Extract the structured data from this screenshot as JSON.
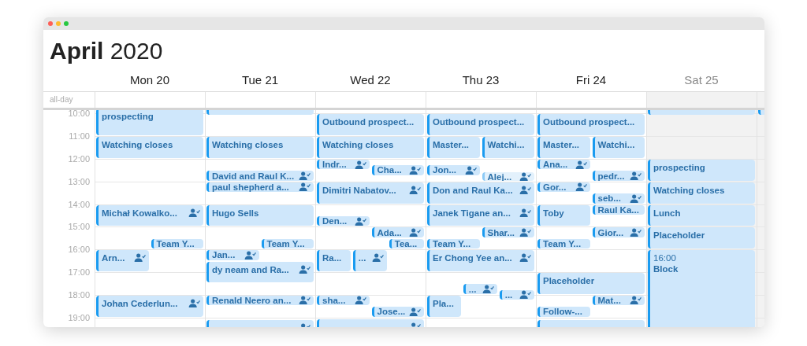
{
  "window": {
    "title": "**April** 2020"
  },
  "all_day_label": "all-day",
  "hours": [
    "10:00",
    "11:00",
    "12:00",
    "13:00",
    "14:00",
    "15:00",
    "16:00",
    "17:00",
    "18:00",
    "19:00"
  ],
  "days": [
    {
      "label": "Mon 20",
      "weekend": false,
      "events": [
        {
          "title": "prospecting",
          "guests": false
        },
        {
          "title": "Watching closes",
          "guests": false
        },
        {
          "title": "Michał Kowalko...",
          "guests": true
        },
        {
          "title": "Team Y...",
          "guests": false
        },
        {
          "title": "Arn...",
          "guests": true
        },
        {
          "title": "Johan Cederlun...",
          "guests": true
        }
      ]
    },
    {
      "label": "Tue 21",
      "weekend": false,
      "events": [
        {
          "guests": false
        },
        {
          "title": "Watching closes",
          "guests": false
        },
        {
          "title": "David and Raul K...",
          "guests": true
        },
        {
          "title": "paul shepherd a...",
          "guests": true
        },
        {
          "title": "Hugo Sells",
          "guests": false
        },
        {
          "title": "Team Y...",
          "guests": false
        },
        {
          "title": "Jan...",
          "guests": true
        },
        {
          "title": "dy neam and Ra...",
          "guests": true
        },
        {
          "title": "Renald Neero an...",
          "guests": true
        },
        {
          "guests": true
        }
      ]
    },
    {
      "label": "Wed 22",
      "weekend": false,
      "events": [
        {
          "title": "Outbound prospect...",
          "guests": false
        },
        {
          "title": "Watching closes",
          "guests": false
        },
        {
          "title": "Indr...",
          "guests": true
        },
        {
          "title": "Cha...",
          "guests": true
        },
        {
          "title": "Dimitri Nabatov...",
          "guests": true
        },
        {
          "title": "Den...",
          "guests": true
        },
        {
          "title": "Ada...",
          "guests": true
        },
        {
          "title": "Tea...",
          "guests": false
        },
        {
          "title": "Ra...",
          "guests": false
        },
        {
          "title": "...",
          "guests": true
        },
        {
          "title": "sha...",
          "guests": true
        },
        {
          "title": "Jose...",
          "guests": true
        },
        {
          "guests": true
        }
      ]
    },
    {
      "label": "Thu 23",
      "weekend": false,
      "events": [
        {
          "title": "Outbound prospect...",
          "guests": false
        },
        {
          "title": "Master...",
          "guests": false
        },
        {
          "title": "Watchi...",
          "guests": false
        },
        {
          "title": "Jon...",
          "guests": true
        },
        {
          "title": "Alej...",
          "guests": true,
          "ghost": true
        },
        {
          "title": "Don  and Raul Ka...",
          "guests": true
        },
        {
          "title": "Janek Tigane an...",
          "guests": true
        },
        {
          "title": "Shar...",
          "guests": true
        },
        {
          "title": "Team Y...",
          "guests": false
        },
        {
          "title": "Er Chong Yee an...",
          "guests": true
        },
        {
          "title": "...",
          "guests": true
        },
        {
          "title": "...",
          "guests": true
        },
        {
          "title": "Pla...",
          "guests": false
        }
      ]
    },
    {
      "label": "Fri 24",
      "weekend": false,
      "events": [
        {
          "title": "Outbound prospect...",
          "guests": false
        },
        {
          "title": "Master...",
          "guests": false
        },
        {
          "title": "Watchi...",
          "guests": false
        },
        {
          "title": "Ana...",
          "guests": true
        },
        {
          "title": "pedr...",
          "guests": true
        },
        {
          "title": "Gor...",
          "guests": true
        },
        {
          "title": "seb...",
          "guests": true
        },
        {
          "title": "Toby",
          "guests": false
        },
        {
          "title": "Raul Ka...",
          "guests": false
        },
        {
          "title": "Gior...",
          "guests": true
        },
        {
          "title": "Team Y...",
          "guests": false
        },
        {
          "title": "Placeholder",
          "guests": false
        },
        {
          "title": "Mat...",
          "guests": true
        },
        {
          "title": "Follow-...",
          "guests": false
        },
        {
          "guests": false
        }
      ]
    },
    {
      "label": "Sat 25",
      "weekend": true,
      "events": [
        {
          "guests": false
        },
        {
          "title": "prospecting",
          "guests": false
        },
        {
          "title": "Watching closes",
          "guests": false
        },
        {
          "title": "Lunch",
          "guests": false
        },
        {
          "title": "Placeholder",
          "guests": false
        },
        {
          "time": "16:00",
          "title": "Block",
          "guests": false
        }
      ]
    },
    {
      "weekend": true,
      "events": [
        {
          "guests": false
        }
      ]
    }
  ]
}
